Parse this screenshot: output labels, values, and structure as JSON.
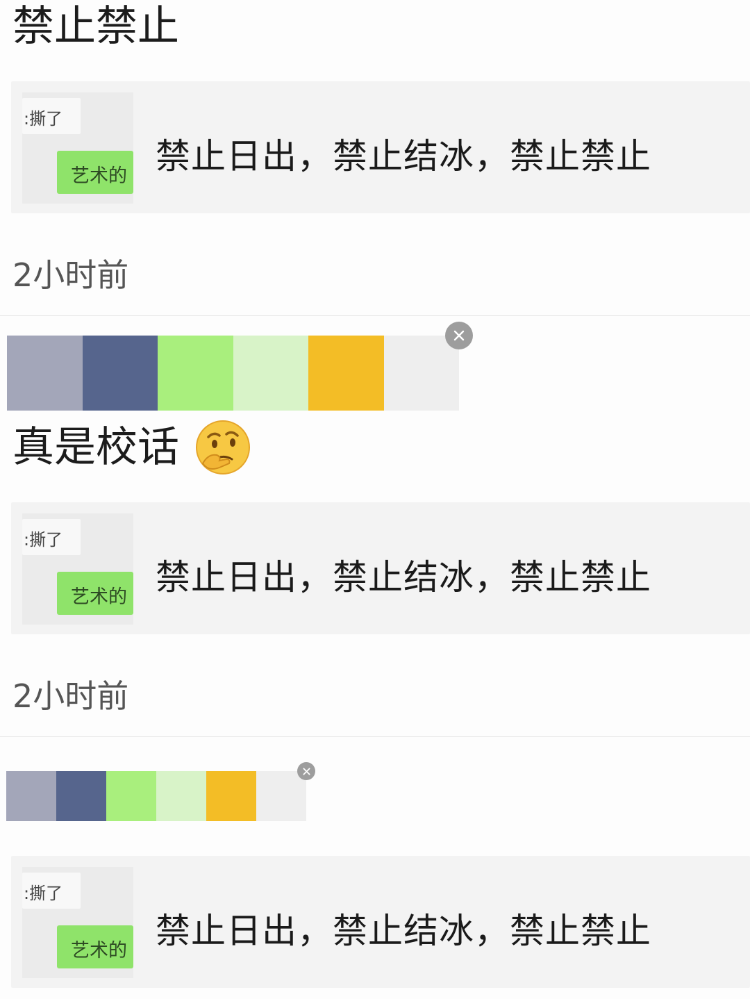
{
  "post1": {
    "title": "禁止禁止",
    "card": {
      "thumb_top_text": ":撕了",
      "thumb_bubble_text": "艺术的",
      "text": "禁止日出，禁止结冰，禁止禁止"
    },
    "time": "2小时前"
  },
  "palette1": {
    "colors": [
      "#a3a6b9",
      "#56658d",
      "#a9ef7d",
      "#d8f3c8",
      "#f3bd26",
      "#eeeeee"
    ]
  },
  "post2": {
    "title": "真是校话",
    "emoji_icon": "thinking-face-emoji",
    "card": {
      "thumb_top_text": ":撕了",
      "thumb_bubble_text": "艺术的",
      "text": "禁止日出，禁止结冰，禁止禁止"
    },
    "time": "2小时前"
  },
  "palette2": {
    "colors": [
      "#a3a6b9",
      "#56658d",
      "#a9ef7d",
      "#d8f3c8",
      "#f3bd26",
      "#eeeeee"
    ]
  },
  "post3": {
    "card": {
      "thumb_top_text": ":撕了",
      "thumb_bubble_text": "艺术的",
      "text": "禁止日出，禁止结冰，禁止禁止"
    }
  }
}
